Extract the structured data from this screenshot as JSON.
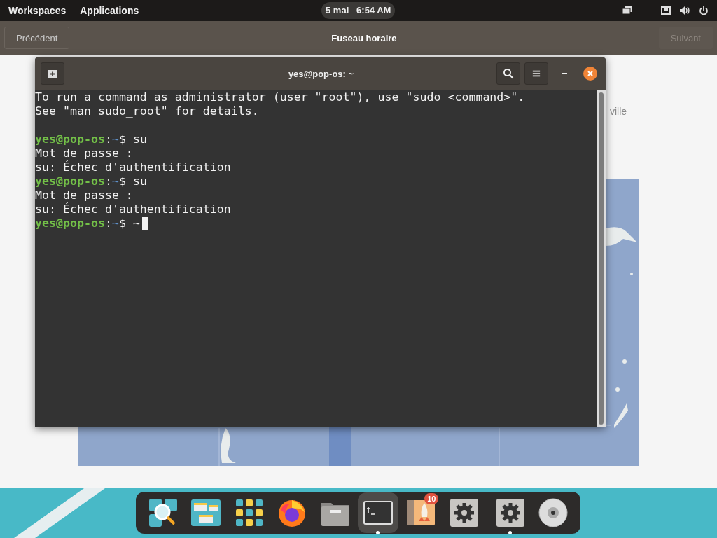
{
  "top_bar": {
    "left": [
      "Workspaces",
      "Applications"
    ],
    "clock": {
      "date": "5 mai",
      "time": "6:54 AM"
    }
  },
  "header": {
    "back": {
      "label": "Précédent",
      "disabled": false
    },
    "title": "Fuseau horaire",
    "next": {
      "label": "Suivant",
      "disabled": true
    }
  },
  "page": {
    "city_label": "ville"
  },
  "terminal": {
    "title": "yes@pop-os: ~",
    "lines": [
      {
        "kind": "output",
        "text": "To run a command as administrator (user \"root\"), use \"sudo <command>\"."
      },
      {
        "kind": "output",
        "text": "See \"man sudo_root\" for details."
      },
      {
        "kind": "blank"
      },
      {
        "kind": "prompt",
        "user": "yes@pop-os",
        "sep": ":",
        "path": "~",
        "symbol": "$",
        "command": "su",
        "cursor": false
      },
      {
        "kind": "output",
        "text": "Mot de passe :"
      },
      {
        "kind": "output",
        "text": "su: Échec d'authentification"
      },
      {
        "kind": "prompt",
        "user": "yes@pop-os",
        "sep": ":",
        "path": "~",
        "symbol": "$",
        "command": "su",
        "cursor": false
      },
      {
        "kind": "output",
        "text": "Mot de passe :"
      },
      {
        "kind": "output",
        "text": "su: Échec d'authentification"
      },
      {
        "kind": "prompt",
        "user": "yes@pop-os",
        "sep": ":",
        "path": "~",
        "symbol": "$",
        "command": "~",
        "cursor": true
      }
    ]
  },
  "dock": {
    "items": [
      {
        "kind": "search",
        "running": false,
        "selected": false
      },
      {
        "kind": "workspaces",
        "running": false,
        "selected": false
      },
      {
        "kind": "apps",
        "running": false,
        "selected": false
      },
      {
        "kind": "browser",
        "running": false,
        "selected": false
      },
      {
        "kind": "files",
        "running": false,
        "selected": false
      },
      {
        "kind": "terminal",
        "running": true,
        "selected": true
      },
      {
        "kind": "shop",
        "running": false,
        "selected": false,
        "badge": "10"
      },
      {
        "kind": "settings",
        "running": false,
        "selected": false
      },
      {
        "kind": "separator"
      },
      {
        "kind": "settings",
        "running": true,
        "selected": false
      },
      {
        "kind": "disc",
        "running": false,
        "selected": false
      }
    ]
  }
}
